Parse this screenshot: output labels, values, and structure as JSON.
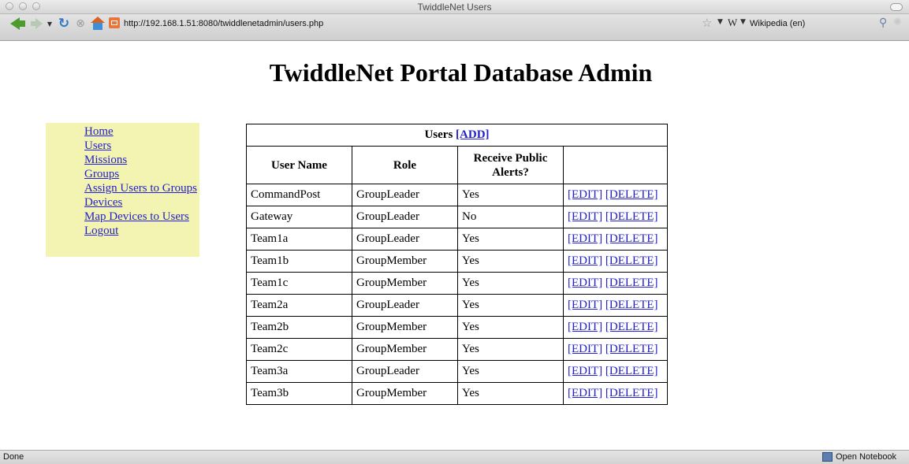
{
  "window": {
    "title": "TwiddleNet Users"
  },
  "toolbar": {
    "url": "http://192.168.1.51:8080/twiddlenetadmin/users.php",
    "search_engine": "Wikipedia (en)"
  },
  "page": {
    "title": "TwiddleNet Portal Database Admin"
  },
  "sidebar": {
    "items": [
      {
        "label": "Home"
      },
      {
        "label": "Users"
      },
      {
        "label": "Missions"
      },
      {
        "label": "Groups"
      },
      {
        "label": "Assign Users to Groups"
      },
      {
        "label": "Devices"
      },
      {
        "label": "Map Devices to Users"
      },
      {
        "label": "Logout"
      }
    ]
  },
  "users_table": {
    "caption": "Users",
    "add_label": "[ADD]",
    "columns": [
      "User Name",
      "Role",
      "Receive Public Alerts?",
      ""
    ],
    "edit_label": "[EDIT]",
    "delete_label": "[DELETE]",
    "rows": [
      {
        "user": "CommandPost",
        "role": "GroupLeader",
        "alerts": "Yes"
      },
      {
        "user": "Gateway",
        "role": "GroupLeader",
        "alerts": "No"
      },
      {
        "user": "Team1a",
        "role": "GroupLeader",
        "alerts": "Yes"
      },
      {
        "user": "Team1b",
        "role": "GroupMember",
        "alerts": "Yes"
      },
      {
        "user": "Team1c",
        "role": "GroupMember",
        "alerts": "Yes"
      },
      {
        "user": "Team2a",
        "role": "GroupLeader",
        "alerts": "Yes"
      },
      {
        "user": "Team2b",
        "role": "GroupMember",
        "alerts": "Yes"
      },
      {
        "user": "Team2c",
        "role": "GroupMember",
        "alerts": "Yes"
      },
      {
        "user": "Team3a",
        "role": "GroupLeader",
        "alerts": "Yes"
      },
      {
        "user": "Team3b",
        "role": "GroupMember",
        "alerts": "Yes"
      }
    ]
  },
  "statusbar": {
    "status": "Done",
    "notebook_label": "Open Notebook"
  },
  "colors": {
    "link": "#2320cc",
    "sidebar_bg": "#f4f4b2"
  }
}
